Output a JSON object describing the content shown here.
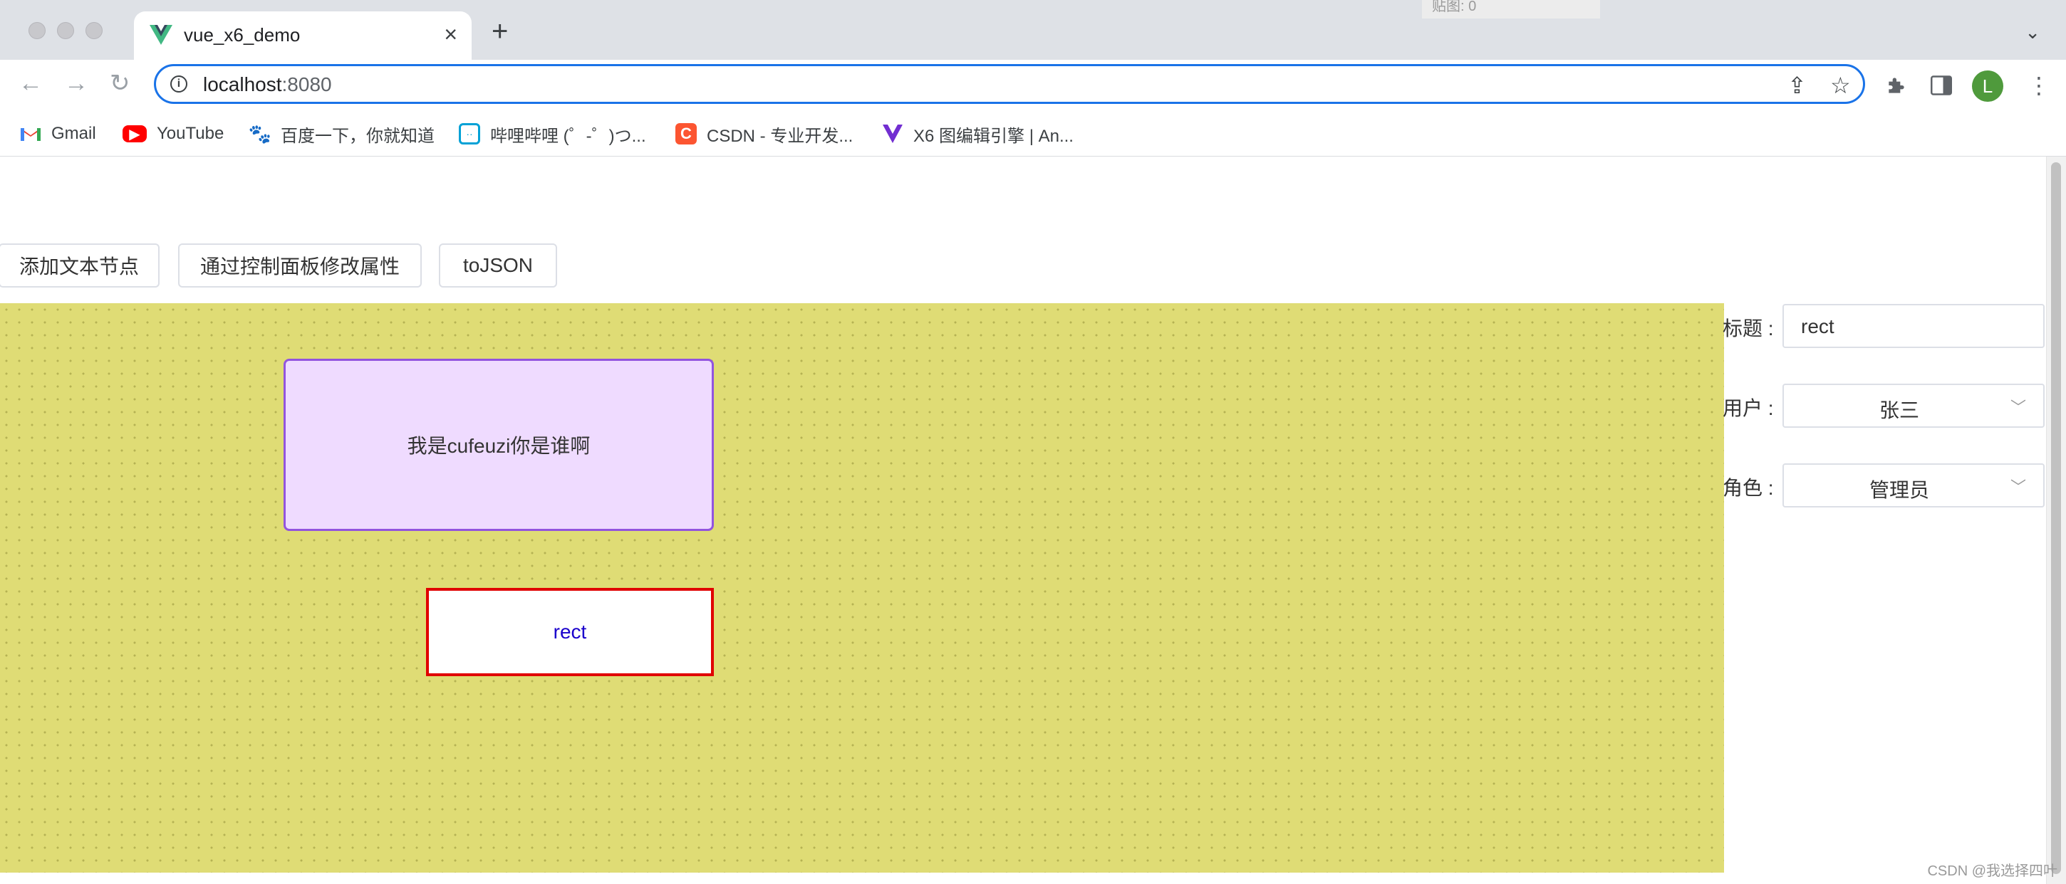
{
  "browser": {
    "tab_title": "vue_x6_demo",
    "url_host": "localhost",
    "url_port": ":8080",
    "profile_initial": "L",
    "tooltip_fragment": "贴图: 0",
    "bookmarks": [
      {
        "label": "Gmail",
        "icon": "gmail-icon"
      },
      {
        "label": "YouTube",
        "icon": "youtube-icon"
      },
      {
        "label": "百度一下，你就知道",
        "icon": "baidu-icon"
      },
      {
        "label": "哔哩哔哩 (゜-゜)つ...",
        "icon": "bilibili-icon"
      },
      {
        "label": "CSDN - 专业开发...",
        "icon": "csdn-icon"
      },
      {
        "label": "X6 图编辑引擎 | An...",
        "icon": "x6-icon"
      }
    ]
  },
  "toolbar": {
    "add_text_node": "添加文本节点",
    "modify_via_panel": "通过控制面板修改属性",
    "to_json": "toJSON"
  },
  "canvas": {
    "background_color": "#dfdc75",
    "purple_node_text": "我是cufeuzi你是谁啊",
    "rect_node_text": "rect"
  },
  "panel": {
    "title_label": "标题 :",
    "title_value": "rect",
    "user_label": "用户 :",
    "user_value": "张三",
    "role_label": "角色 :",
    "role_value": "管理员"
  },
  "watermark": "CSDN @我选择四叶"
}
